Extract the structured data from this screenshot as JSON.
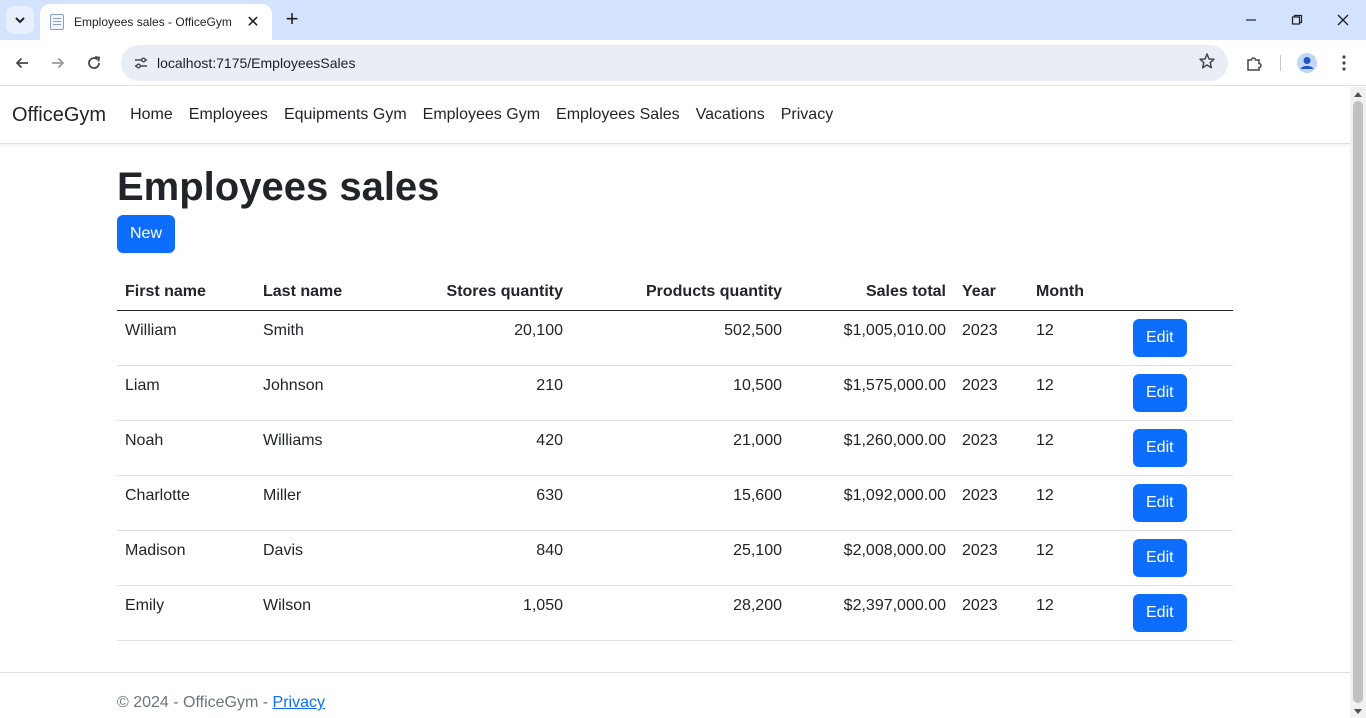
{
  "browser": {
    "tab_title": "Employees sales - OfficeGym",
    "url": "localhost:7175/EmployeesSales",
    "new_tab_symbol": "+",
    "close_symbol": "✕"
  },
  "nav": {
    "brand": "OfficeGym",
    "links": [
      "Home",
      "Employees",
      "Equipments Gym",
      "Employees Gym",
      "Employees Sales",
      "Vacations",
      "Privacy"
    ]
  },
  "page": {
    "title": "Employees sales",
    "new_button": "New"
  },
  "table": {
    "headers": {
      "first_name": "First name",
      "last_name": "Last name",
      "stores_quantity": "Stores quantity",
      "products_quantity": "Products quantity",
      "sales_total": "Sales total",
      "year": "Year",
      "month": "Month"
    },
    "edit_label": "Edit",
    "rows": [
      {
        "first_name": "William",
        "last_name": "Smith",
        "stores_quantity": "20,100",
        "products_quantity": "502,500",
        "sales_total": "$1,005,010.00",
        "year": "2023",
        "month": "12"
      },
      {
        "first_name": "Liam",
        "last_name": "Johnson",
        "stores_quantity": "210",
        "products_quantity": "10,500",
        "sales_total": "$1,575,000.00",
        "year": "2023",
        "month": "12"
      },
      {
        "first_name": "Noah",
        "last_name": "Williams",
        "stores_quantity": "420",
        "products_quantity": "21,000",
        "sales_total": "$1,260,000.00",
        "year": "2023",
        "month": "12"
      },
      {
        "first_name": "Charlotte",
        "last_name": "Miller",
        "stores_quantity": "630",
        "products_quantity": "15,600",
        "sales_total": "$1,092,000.00",
        "year": "2023",
        "month": "12"
      },
      {
        "first_name": "Madison",
        "last_name": "Davis",
        "stores_quantity": "840",
        "products_quantity": "25,100",
        "sales_total": "$2,008,000.00",
        "year": "2023",
        "month": "12"
      },
      {
        "first_name": "Emily",
        "last_name": "Wilson",
        "stores_quantity": "1,050",
        "products_quantity": "28,200",
        "sales_total": "$2,397,000.00",
        "year": "2023",
        "month": "12"
      }
    ]
  },
  "footer": {
    "text": "© 2024 - OfficeGym - ",
    "link": "Privacy"
  },
  "colors": {
    "primary": "#0d6efd",
    "tabstrip": "#d3e3fd",
    "omnibox": "#e9eef6"
  }
}
